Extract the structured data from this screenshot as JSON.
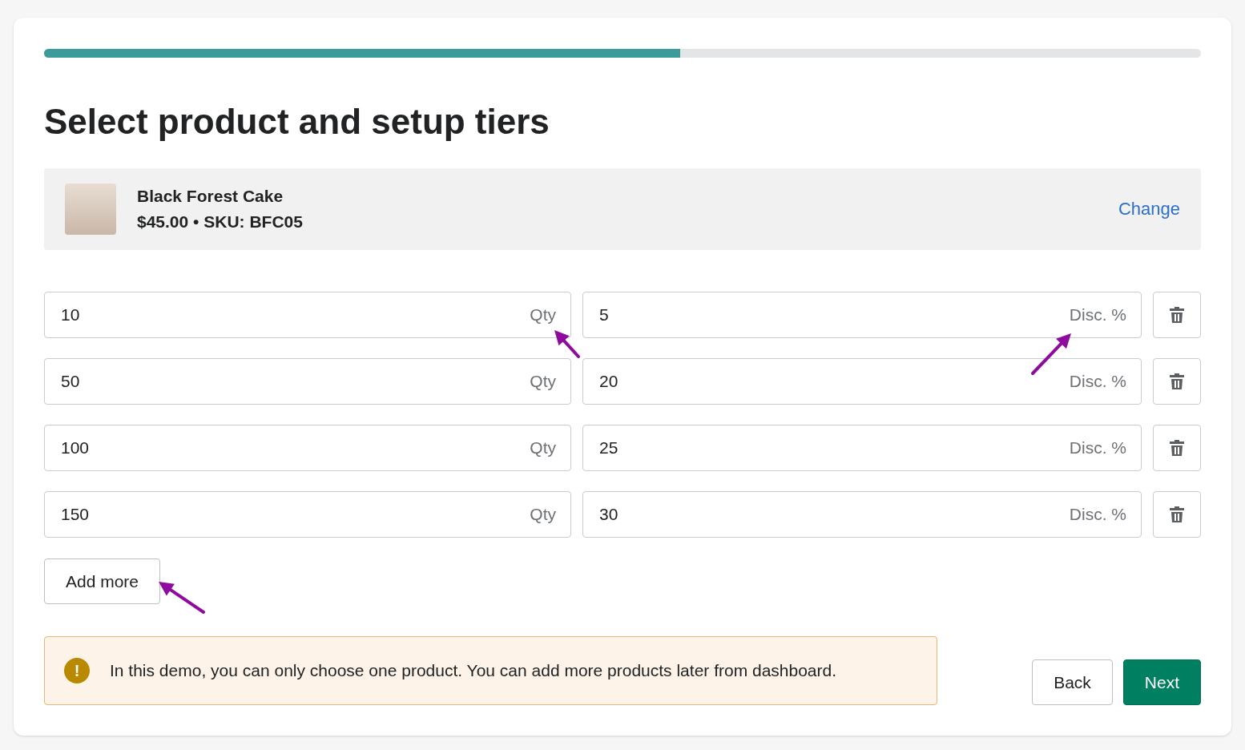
{
  "progress": {
    "level": 0.55
  },
  "title": "Select product and setup tiers",
  "product": {
    "name": "Black Forest Cake",
    "meta": "$45.00 • SKU: BFC05",
    "change_link": "Change"
  },
  "tiers": [
    {
      "quantity": "10",
      "quantity_suffix": "Qty",
      "discount": "5",
      "discount_suffix": "Disc. %"
    },
    {
      "quantity": "50",
      "quantity_suffix": "Qty",
      "discount": "20",
      "discount_suffix": "Disc. %"
    },
    {
      "quantity": "100",
      "quantity_suffix": "Qty",
      "discount": "25",
      "discount_suffix": "Disc. %"
    },
    {
      "quantity": "150",
      "quantity_suffix": "Qty",
      "discount": "30",
      "discount_suffix": "Disc. %"
    }
  ],
  "add_button": "Add more",
  "notice": {
    "icon": "!",
    "text": "In this demo, you can only choose one product. You can add more products later from dashboard."
  },
  "buttons": [
    {
      "label": "Back",
      "kind": "secondary"
    },
    {
      "label": "Next",
      "kind": "primary"
    }
  ]
}
